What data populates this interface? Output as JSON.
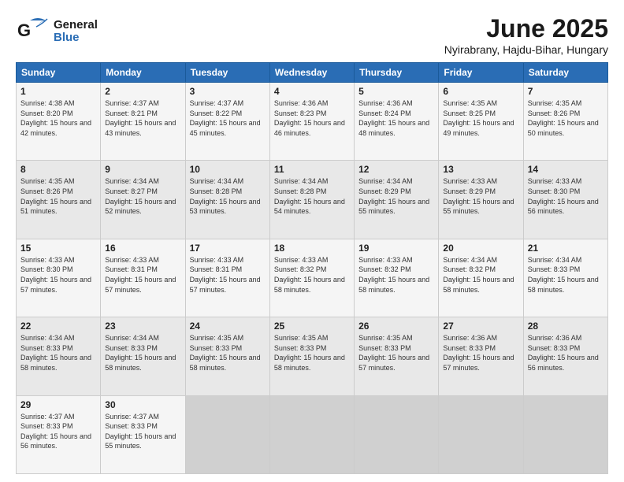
{
  "header": {
    "logo_line1": "General",
    "logo_line2": "Blue",
    "title": "June 2025",
    "subtitle": "Nyirabrany, Hajdu-Bihar, Hungary"
  },
  "calendar": {
    "days_header": [
      "Sunday",
      "Monday",
      "Tuesday",
      "Wednesday",
      "Thursday",
      "Friday",
      "Saturday"
    ],
    "weeks": [
      [
        null,
        null,
        null,
        null,
        null,
        null,
        null,
        {
          "day": "1",
          "sunrise": "Sunrise: 4:38 AM",
          "sunset": "Sunset: 8:20 PM",
          "daylight": "Daylight: 15 hours and 42 minutes."
        },
        {
          "day": "2",
          "sunrise": "Sunrise: 4:37 AM",
          "sunset": "Sunset: 8:21 PM",
          "daylight": "Daylight: 15 hours and 43 minutes."
        },
        {
          "day": "3",
          "sunrise": "Sunrise: 4:37 AM",
          "sunset": "Sunset: 8:22 PM",
          "daylight": "Daylight: 15 hours and 45 minutes."
        },
        {
          "day": "4",
          "sunrise": "Sunrise: 4:36 AM",
          "sunset": "Sunset: 8:23 PM",
          "daylight": "Daylight: 15 hours and 46 minutes."
        },
        {
          "day": "5",
          "sunrise": "Sunrise: 4:36 AM",
          "sunset": "Sunset: 8:24 PM",
          "daylight": "Daylight: 15 hours and 48 minutes."
        },
        {
          "day": "6",
          "sunrise": "Sunrise: 4:35 AM",
          "sunset": "Sunset: 8:25 PM",
          "daylight": "Daylight: 15 hours and 49 minutes."
        },
        {
          "day": "7",
          "sunrise": "Sunrise: 4:35 AM",
          "sunset": "Sunset: 8:26 PM",
          "daylight": "Daylight: 15 hours and 50 minutes."
        }
      ],
      [
        {
          "day": "8",
          "sunrise": "Sunrise: 4:35 AM",
          "sunset": "Sunset: 8:26 PM",
          "daylight": "Daylight: 15 hours and 51 minutes."
        },
        {
          "day": "9",
          "sunrise": "Sunrise: 4:34 AM",
          "sunset": "Sunset: 8:27 PM",
          "daylight": "Daylight: 15 hours and 52 minutes."
        },
        {
          "day": "10",
          "sunrise": "Sunrise: 4:34 AM",
          "sunset": "Sunset: 8:28 PM",
          "daylight": "Daylight: 15 hours and 53 minutes."
        },
        {
          "day": "11",
          "sunrise": "Sunrise: 4:34 AM",
          "sunset": "Sunset: 8:28 PM",
          "daylight": "Daylight: 15 hours and 54 minutes."
        },
        {
          "day": "12",
          "sunrise": "Sunrise: 4:34 AM",
          "sunset": "Sunset: 8:29 PM",
          "daylight": "Daylight: 15 hours and 55 minutes."
        },
        {
          "day": "13",
          "sunrise": "Sunrise: 4:33 AM",
          "sunset": "Sunset: 8:29 PM",
          "daylight": "Daylight: 15 hours and 55 minutes."
        },
        {
          "day": "14",
          "sunrise": "Sunrise: 4:33 AM",
          "sunset": "Sunset: 8:30 PM",
          "daylight": "Daylight: 15 hours and 56 minutes."
        }
      ],
      [
        {
          "day": "15",
          "sunrise": "Sunrise: 4:33 AM",
          "sunset": "Sunset: 8:30 PM",
          "daylight": "Daylight: 15 hours and 57 minutes."
        },
        {
          "day": "16",
          "sunrise": "Sunrise: 4:33 AM",
          "sunset": "Sunset: 8:31 PM",
          "daylight": "Daylight: 15 hours and 57 minutes."
        },
        {
          "day": "17",
          "sunrise": "Sunrise: 4:33 AM",
          "sunset": "Sunset: 8:31 PM",
          "daylight": "Daylight: 15 hours and 57 minutes."
        },
        {
          "day": "18",
          "sunrise": "Sunrise: 4:33 AM",
          "sunset": "Sunset: 8:32 PM",
          "daylight": "Daylight: 15 hours and 58 minutes."
        },
        {
          "day": "19",
          "sunrise": "Sunrise: 4:33 AM",
          "sunset": "Sunset: 8:32 PM",
          "daylight": "Daylight: 15 hours and 58 minutes."
        },
        {
          "day": "20",
          "sunrise": "Sunrise: 4:34 AM",
          "sunset": "Sunset: 8:32 PM",
          "daylight": "Daylight: 15 hours and 58 minutes."
        },
        {
          "day": "21",
          "sunrise": "Sunrise: 4:34 AM",
          "sunset": "Sunset: 8:33 PM",
          "daylight": "Daylight: 15 hours and 58 minutes."
        }
      ],
      [
        {
          "day": "22",
          "sunrise": "Sunrise: 4:34 AM",
          "sunset": "Sunset: 8:33 PM",
          "daylight": "Daylight: 15 hours and 58 minutes."
        },
        {
          "day": "23",
          "sunrise": "Sunrise: 4:34 AM",
          "sunset": "Sunset: 8:33 PM",
          "daylight": "Daylight: 15 hours and 58 minutes."
        },
        {
          "day": "24",
          "sunrise": "Sunrise: 4:35 AM",
          "sunset": "Sunset: 8:33 PM",
          "daylight": "Daylight: 15 hours and 58 minutes."
        },
        {
          "day": "25",
          "sunrise": "Sunrise: 4:35 AM",
          "sunset": "Sunset: 8:33 PM",
          "daylight": "Daylight: 15 hours and 58 minutes."
        },
        {
          "day": "26",
          "sunrise": "Sunrise: 4:35 AM",
          "sunset": "Sunset: 8:33 PM",
          "daylight": "Daylight: 15 hours and 57 minutes."
        },
        {
          "day": "27",
          "sunrise": "Sunrise: 4:36 AM",
          "sunset": "Sunset: 8:33 PM",
          "daylight": "Daylight: 15 hours and 57 minutes."
        },
        {
          "day": "28",
          "sunrise": "Sunrise: 4:36 AM",
          "sunset": "Sunset: 8:33 PM",
          "daylight": "Daylight: 15 hours and 56 minutes."
        }
      ],
      [
        {
          "day": "29",
          "sunrise": "Sunrise: 4:37 AM",
          "sunset": "Sunset: 8:33 PM",
          "daylight": "Daylight: 15 hours and 56 minutes."
        },
        {
          "day": "30",
          "sunrise": "Sunrise: 4:37 AM",
          "sunset": "Sunset: 8:33 PM",
          "daylight": "Daylight: 15 hours and 55 minutes."
        },
        null,
        null,
        null,
        null,
        null
      ]
    ]
  }
}
